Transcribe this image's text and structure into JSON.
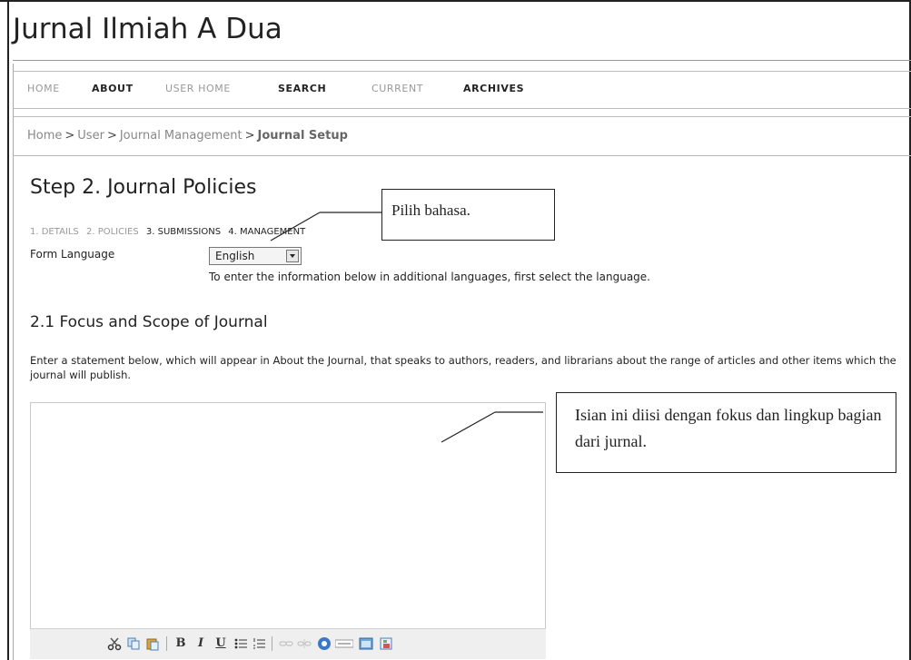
{
  "site_title": "Jurnal Ilmiah A Dua",
  "nav": {
    "home": "HOME",
    "about": "ABOUT",
    "user_home": "USER HOME",
    "search": "SEARCH",
    "current": "CURRENT",
    "archives": "ARCHIVES"
  },
  "breadcrumb": {
    "home": "Home",
    "user": "User",
    "journal_management": "Journal Management",
    "current": "Journal Setup",
    "separator": ">"
  },
  "page_heading": "Step 2. Journal Policies",
  "steps": {
    "details": "1. DETAILS",
    "policies": "2. POLICIES",
    "submissions": "3. SUBMISSIONS",
    "management": "4. MANAGEMENT"
  },
  "form_language": {
    "label": "Form Language",
    "selected": "English",
    "help": "To enter the information below in additional languages, first select the language."
  },
  "section": {
    "heading": "2.1 Focus and Scope of Journal",
    "description": "Enter a statement below, which will appear in About the Journal, that speaks to authors, readers, and librarians about the range of articles and other items which the journal will publish."
  },
  "editor": {
    "value": "",
    "toolbar_icons": [
      "cut-icon",
      "copy-icon",
      "paste-icon",
      "bold-icon",
      "italic-icon",
      "underline-icon",
      "bullet-list-icon",
      "numbered-list-icon",
      "link-icon",
      "unlink-icon",
      "help-icon",
      "html-icon",
      "fullscreen-icon",
      "image-icon"
    ],
    "bold_label": "B",
    "italic_label": "I",
    "underline_label": "U"
  },
  "annotations": {
    "language_note": "Pilih bahasa.",
    "focus_note": "Isian ini diisi dengan fokus dan lingkup bagian dari jurnal."
  },
  "colors": {
    "nav_active": "#222222",
    "nav_inactive": "#999999",
    "toolbar_bg": "#efefef"
  }
}
